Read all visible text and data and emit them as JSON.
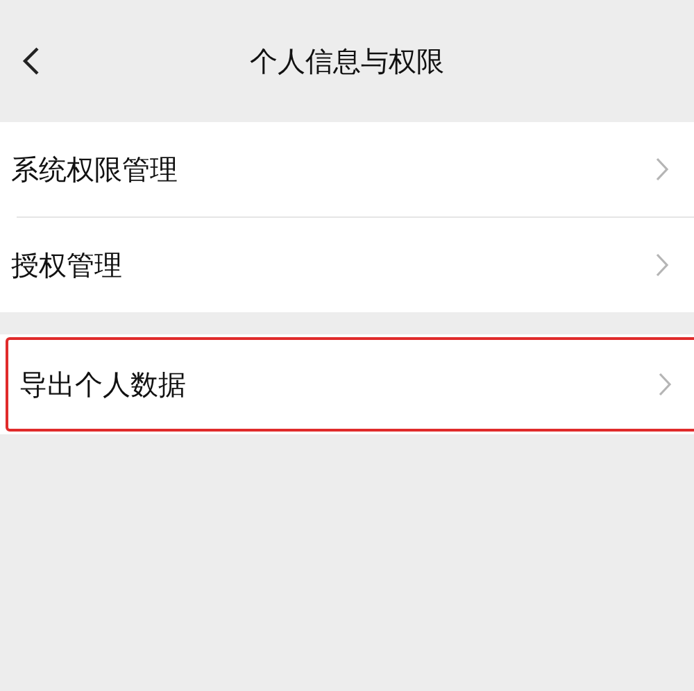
{
  "header": {
    "title": "个人信息与权限"
  },
  "groups": [
    {
      "items": [
        {
          "label": "系统权限管理",
          "highlighted": false
        },
        {
          "label": "授权管理",
          "highlighted": false
        }
      ]
    },
    {
      "items": [
        {
          "label": "导出个人数据",
          "highlighted": true
        }
      ]
    }
  ]
}
